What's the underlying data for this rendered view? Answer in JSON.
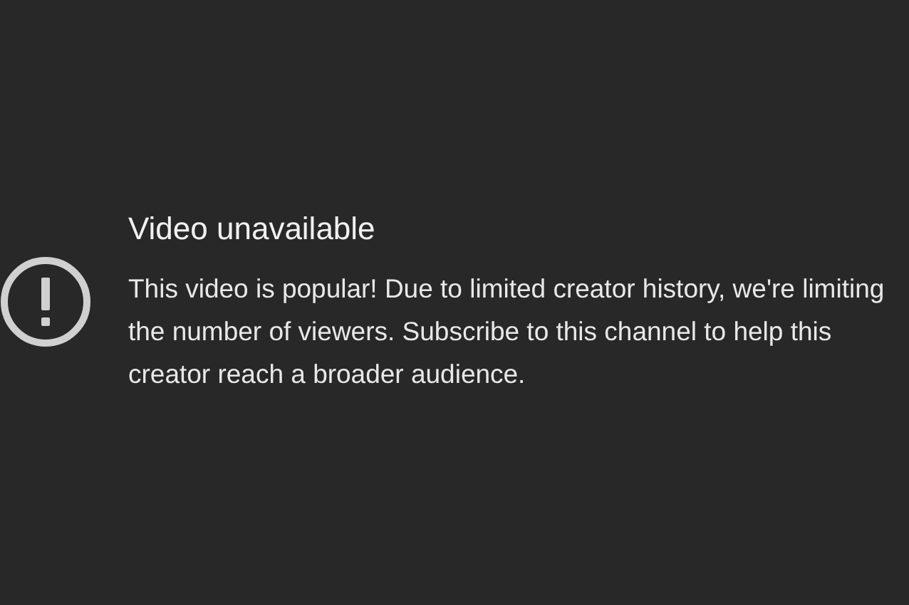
{
  "error": {
    "title": "Video unavailable",
    "message": "This video is popular! Due to limited creator history, we're limiting the number of viewers. Subscribe to this channel to help this creator reach a broader audience."
  }
}
